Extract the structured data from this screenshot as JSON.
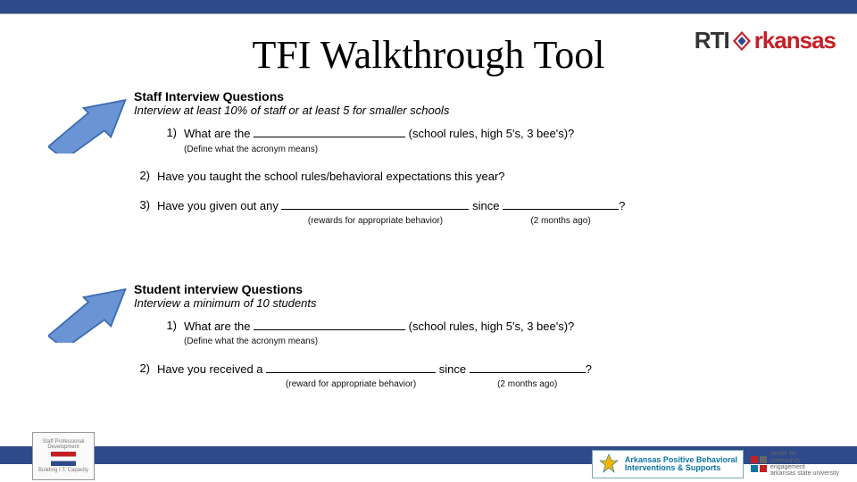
{
  "colors": {
    "bar": "#2e4a8a",
    "accent_red": "#c32026",
    "pbis_blue": "#0b74a3"
  },
  "logo": {
    "rti": "RTI",
    "arkansas": "rkansas"
  },
  "title": "TFI Walkthrough Tool",
  "staff": {
    "heading": "Staff Interview Questions",
    "subheading": "Interview at least 10% of staff or at least 5 for smaller schools",
    "q1_num": "1)",
    "q1_lead": "What are the ",
    "q1_tail": " (school rules, high 5's, 3 bee's)?",
    "q1_sub": "(Define what the acronym means)",
    "q2_num": "2)",
    "q2": "Have you taught the school rules/behavioral expectations this year?",
    "q3_num": "3)",
    "q3_lead": "Have you given out any ",
    "q3_mid": " since ",
    "q3_tail": "?",
    "q3_sub1": "(rewards for appropriate behavior)",
    "q3_sub2": "(2 months ago)"
  },
  "student": {
    "heading": "Student interview Questions",
    "subheading": "Interview a minimum of 10 students",
    "q1_num": "1)",
    "q1_lead": "What are the ",
    "q1_tail": " (school rules, high 5's, 3 bee's)?",
    "q1_sub": "(Define what the acronym means)",
    "q2_num": "2)",
    "q2_lead": "Have you received a ",
    "q2_mid": " since ",
    "q2_tail": "?",
    "q2_sub1": "(reward for appropriate behavior)",
    "q2_sub2": "(2 months ago)"
  },
  "footer": {
    "left_caption_top": "Staff Professional Development",
    "left_caption_bottom": "Building I.T. Capacity",
    "pbis_line1": "Arkansas Positive Behavioral",
    "pbis_line2": "Interventions & Supports",
    "cce_line1": "center for",
    "cce_line2": "community",
    "cce_line3": "engagement",
    "cce_line4": "arkansas state university"
  }
}
